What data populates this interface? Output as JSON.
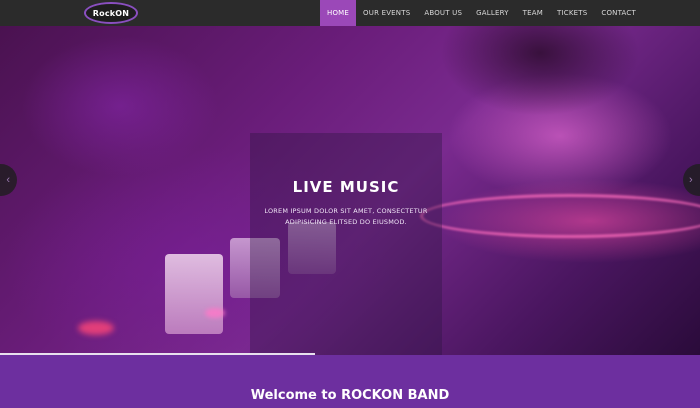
{
  "brand": {
    "logo_text": "RockON"
  },
  "nav": {
    "items": [
      {
        "label": "HOME",
        "active": true
      },
      {
        "label": "OUR EVENTS",
        "active": false
      },
      {
        "label": "ABOUT US",
        "active": false
      },
      {
        "label": "GALLERY",
        "active": false
      },
      {
        "label": "TEAM",
        "active": false
      },
      {
        "label": "TICKETS",
        "active": false
      },
      {
        "label": "CONTACT",
        "active": false
      }
    ]
  },
  "hero": {
    "title": "LIVE MUSIC",
    "text": "LOREM IPSUM DOLOR SIT AMET, CONSECTETUR ADIPISICING ELITSED DO EIUSMOD.",
    "prev_icon": "chevron-left-icon",
    "next_icon": "chevron-right-icon",
    "prev_glyph": "‹",
    "next_glyph": "›",
    "slide_progress": 0.45
  },
  "welcome": {
    "title": "Welcome to ROCKON BAND"
  },
  "colors": {
    "accent": "#9b48b8",
    "navbar": "#2b2b2b",
    "section": "#6d2f9f"
  }
}
